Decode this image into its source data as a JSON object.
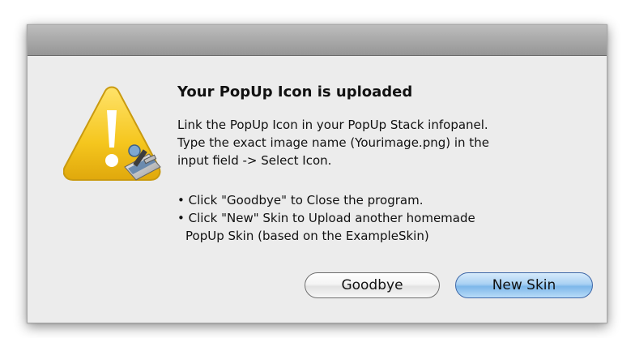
{
  "dialog": {
    "title": "Your PopUp Icon is uploaded",
    "message_lines": [
      "Link the PopUp Icon in your PopUp Stack infopanel.",
      "Type the exact image name (Yourimage.png) in the",
      "input field -> Select Icon."
    ],
    "bullet_lines": [
      "• Click \"Goodbye\" to Close the program.",
      "• Click \"New\" Skin to Upload another homemade",
      "PopUp Skin (based on the ExampleSkin)"
    ],
    "buttons": {
      "goodbye_label": "Goodbye",
      "new_skin_label": "New Skin"
    },
    "icon": "warning-triangle-icon"
  },
  "colors": {
    "dialog_background": "#ececec",
    "titlebar": "#a7a7a7",
    "warning_yellow": "#f5c61e",
    "default_button_blue": "#7db7ea"
  }
}
